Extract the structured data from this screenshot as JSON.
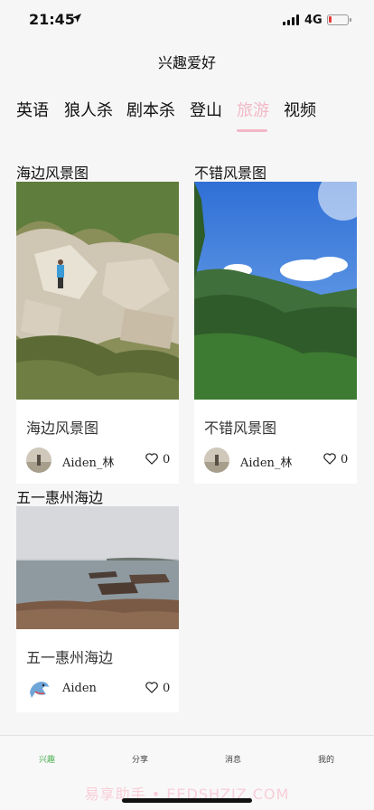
{
  "status_bar": {
    "time": "21:45",
    "network": "4G",
    "battery_level": 0.15,
    "battery_color": "#e53935"
  },
  "nav": {
    "title": "兴趣爱好"
  },
  "tabs": [
    {
      "label": "英语"
    },
    {
      "label": "狼人杀"
    },
    {
      "label": "剧本杀"
    },
    {
      "label": "登山"
    },
    {
      "label": "旅游",
      "active": true
    },
    {
      "label": "视频"
    }
  ],
  "posts": [
    {
      "section_title": "海边风景图",
      "title": "海边风景图",
      "author": "Aiden_林",
      "likes": "0",
      "image": "rocky-hillside-photo",
      "avatar": "avatar-photo"
    },
    {
      "section_title": "不错风景图",
      "title": "不错风景图",
      "author": "Aiden_林",
      "likes": "0",
      "image": "mountain-valley-photo",
      "avatar": "avatar-photo"
    },
    {
      "section_title": "五一惠州海边",
      "title": "五一惠州海边",
      "author": "Aiden",
      "likes": "0",
      "image": "rocky-seashore-photo",
      "avatar": "dolphin-avatar"
    }
  ],
  "tabbar": [
    {
      "label": "兴趣",
      "active": true
    },
    {
      "label": "分享"
    },
    {
      "label": "消息"
    },
    {
      "label": "我的"
    }
  ],
  "watermark": "易享助手 • EEDSHZJZ.COM",
  "colors": {
    "accent_tab": "#f2b8c6",
    "active_tabbar": "#4caf50",
    "background": "#f6f6f6"
  }
}
